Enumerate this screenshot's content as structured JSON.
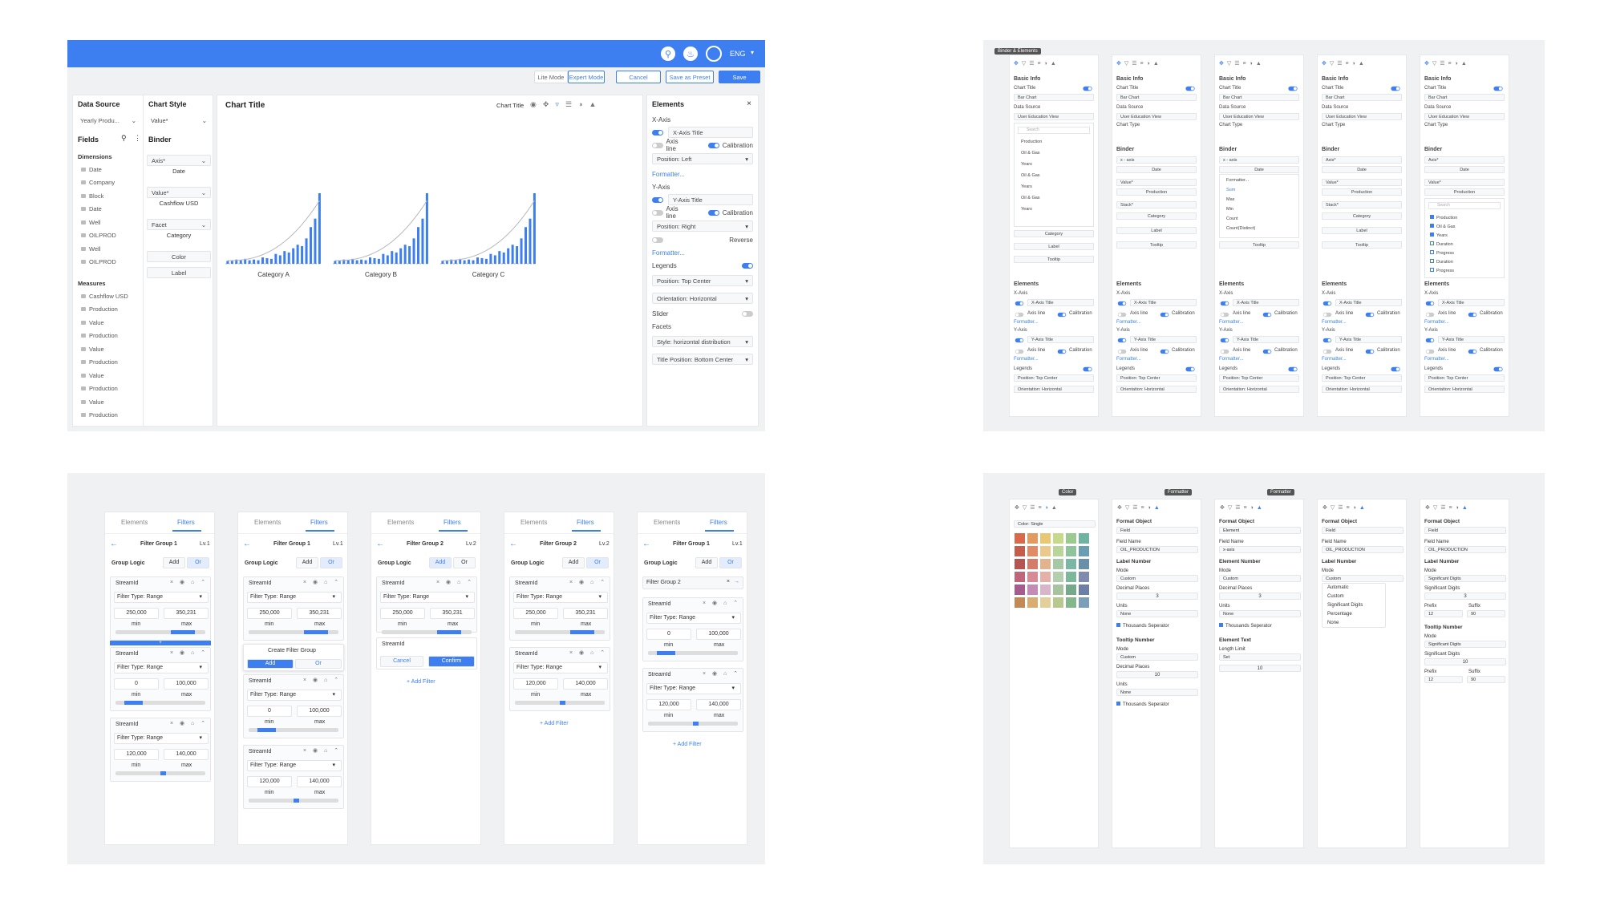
{
  "header": {
    "lang": "ENG"
  },
  "toolbar": {
    "lite": "Lite Mode",
    "expert": "Expert Mode",
    "cancel": "Cancel",
    "save_preset": "Save as Preset",
    "save": "Save"
  },
  "datasource": {
    "title": "Data Source",
    "value": "Yearly Produ...",
    "fields": "Fields",
    "dimensions": "Dimensions",
    "dims": [
      "Date",
      "Company",
      "Block",
      "Date",
      "Well",
      "OILPROD",
      "Well",
      "OILPROD"
    ],
    "measures": "Measures",
    "meas": [
      "Cashflow USD",
      "Production",
      "Value",
      "Production",
      "Value",
      "Production",
      "Value",
      "Production",
      "Value",
      "Production"
    ]
  },
  "chartstyle": {
    "title": "Chart Style",
    "value": "Value*",
    "binder": "Binder",
    "axis": "Axis*",
    "axis_val": "Date",
    "value_val": "Cashflow USD",
    "facet": "Facet",
    "facet_val": "Category",
    "color": "Color",
    "label": "Label"
  },
  "chart": {
    "title": "Chart Title",
    "toolbar_title": "Chart Title",
    "cats": [
      "Category A",
      "Category B",
      "Category C"
    ],
    "bars": [
      0.04,
      0.05,
      0.06,
      0.05,
      0.07,
      0.05,
      0.06,
      0.05,
      0.09,
      0.08,
      0.07,
      0.14,
      0.12,
      0.18,
      0.16,
      0.22,
      0.27,
      0.25,
      0.36,
      0.52,
      0.64,
      1.0
    ]
  },
  "elements": {
    "title": "Elements",
    "xaxis": "X-Axis",
    "xtitle": "X-Axis Title",
    "axisline": "Axis line",
    "calibration": "Calibration",
    "pos_left": "Position: Left",
    "formatter": "Formatter...",
    "yaxis": "Y-Axis",
    "ytitle": "Y-Axis Title",
    "pos_right": "Position: Right",
    "reverse": "Reverse",
    "legends": "Legends",
    "pos_top": "Position: Top Center",
    "orient": "Orientation: Horizontal",
    "slider": "Slider",
    "facets": "Facets",
    "style": "Style: horizontal distribution",
    "title_pos": "Title Position: Bottom Center"
  },
  "mini": {
    "tooltip": "Binder & Elements",
    "basic": "Basic Info",
    "chart_title": "Chart Title",
    "bar_chart": "Bar Chart",
    "data_source": "Data Source",
    "view": "User Education View",
    "chart_type": "Chart Type",
    "binder": "Binder",
    "axis": "Axis*",
    "date": "Date",
    "xaxis_sel": "x - axis",
    "value": "Value*",
    "production": "Production",
    "stack": "Stack*",
    "category": "Category",
    "label": "Label",
    "tooltip_sel": "Tooltip",
    "elements": "Elements",
    "x_axis": "X-Axis",
    "xtitle": "X-Axis Title",
    "axis_line": "Axis line",
    "calibration": "Calibration",
    "formatter": "Formatter...",
    "y_axis": "Y-Axis",
    "ytitle": "Y-Axis Title",
    "legends": "Legends",
    "pos": "Position: Top Center",
    "orient": "Orientation: Horizontal",
    "search": "Search",
    "tree": [
      "Production",
      "Oil & Gas",
      "Years",
      "Oil & Gas",
      "Years",
      "Oil & Gas",
      "Years"
    ],
    "agg": [
      "Formatter...",
      "Sum",
      "Max",
      "Min",
      "Count",
      "Count(Distinct)"
    ],
    "checks": [
      "Production",
      "Oil & Gas",
      "Years",
      "Duration",
      "Progress",
      "Duration",
      "Progress"
    ]
  },
  "filters": {
    "elements": "Elements",
    "filters": "Filters",
    "group1": "Filter Group 1",
    "group2": "Filter Group 2",
    "lv1": "Lv.1",
    "lv2": "Lv.2",
    "logic": "Group Logic",
    "add": "Add",
    "or": "Or",
    "stream": "StreamId",
    "ftype": "Filter Type: Range",
    "v1a": "250,000",
    "v1b": "350,231",
    "v2a": "0",
    "v2b": "100,000",
    "v3a": "120,000",
    "v3b": "140,000",
    "min": "min",
    "max": "max",
    "create": "Create Filter Group",
    "cancel": "Cancel",
    "confirm": "Confirm",
    "add_filter": "+ Add Filter",
    "plus": "+"
  },
  "format": {
    "color_tip": "Color",
    "fmt_tip": "Formatter",
    "color_single": "Color: Single",
    "format_obj": "Format Object",
    "field": "Field",
    "element": "Element",
    "field_name": "Field Name",
    "oilprod": "OIL_PRODUCTION",
    "xaxis": "x-axis",
    "label_num": "Label Number",
    "elem_num": "Element Number",
    "mode": "Mode",
    "custom": "Custom",
    "decimal": "Decimal Places",
    "units": "Units",
    "none": "None",
    "thousands": "Thousands Seperator",
    "tooltip_num": "Tooltip Number",
    "three": "3",
    "ten": "10",
    "elem_text": "Element Text",
    "length": "Length Limit",
    "set": "Set",
    "modes": [
      "Automatic",
      "Custom",
      "Significant Digits",
      "Percentage",
      "None"
    ],
    "sig": "Significant Digits",
    "sig_label": "Significant Digits",
    "prefix": "Prefix",
    "suffix": "Suffix",
    "p12": "12",
    "s90": "90"
  },
  "palette": [
    "#d9694a",
    "#e39a5e",
    "#e8c873",
    "#c7d98a",
    "#9cc98f",
    "#6fb3a3",
    "#c65c4a",
    "#e08a66",
    "#ecc98a",
    "#b9d59a",
    "#8ec39c",
    "#6a9fb3",
    "#b65451",
    "#d47b6a",
    "#e3b28f",
    "#a6c8a4",
    "#7cb6a5",
    "#6a8fa8",
    "#c0667a",
    "#d88a96",
    "#e4b0a8",
    "#b3cfae",
    "#7eb89b",
    "#7f8cae",
    "#a65c8e",
    "#c38bb5",
    "#d9b5c9",
    "#a8c49f",
    "#74a98a",
    "#6e7fa6",
    "#c48a55",
    "#d9ad72",
    "#e3cf9a",
    "#b7c98e",
    "#84b88c",
    "#7b9fb8"
  ],
  "colors": {
    "accent": "#3d7ff1",
    "bg": "#f0f1f2"
  }
}
